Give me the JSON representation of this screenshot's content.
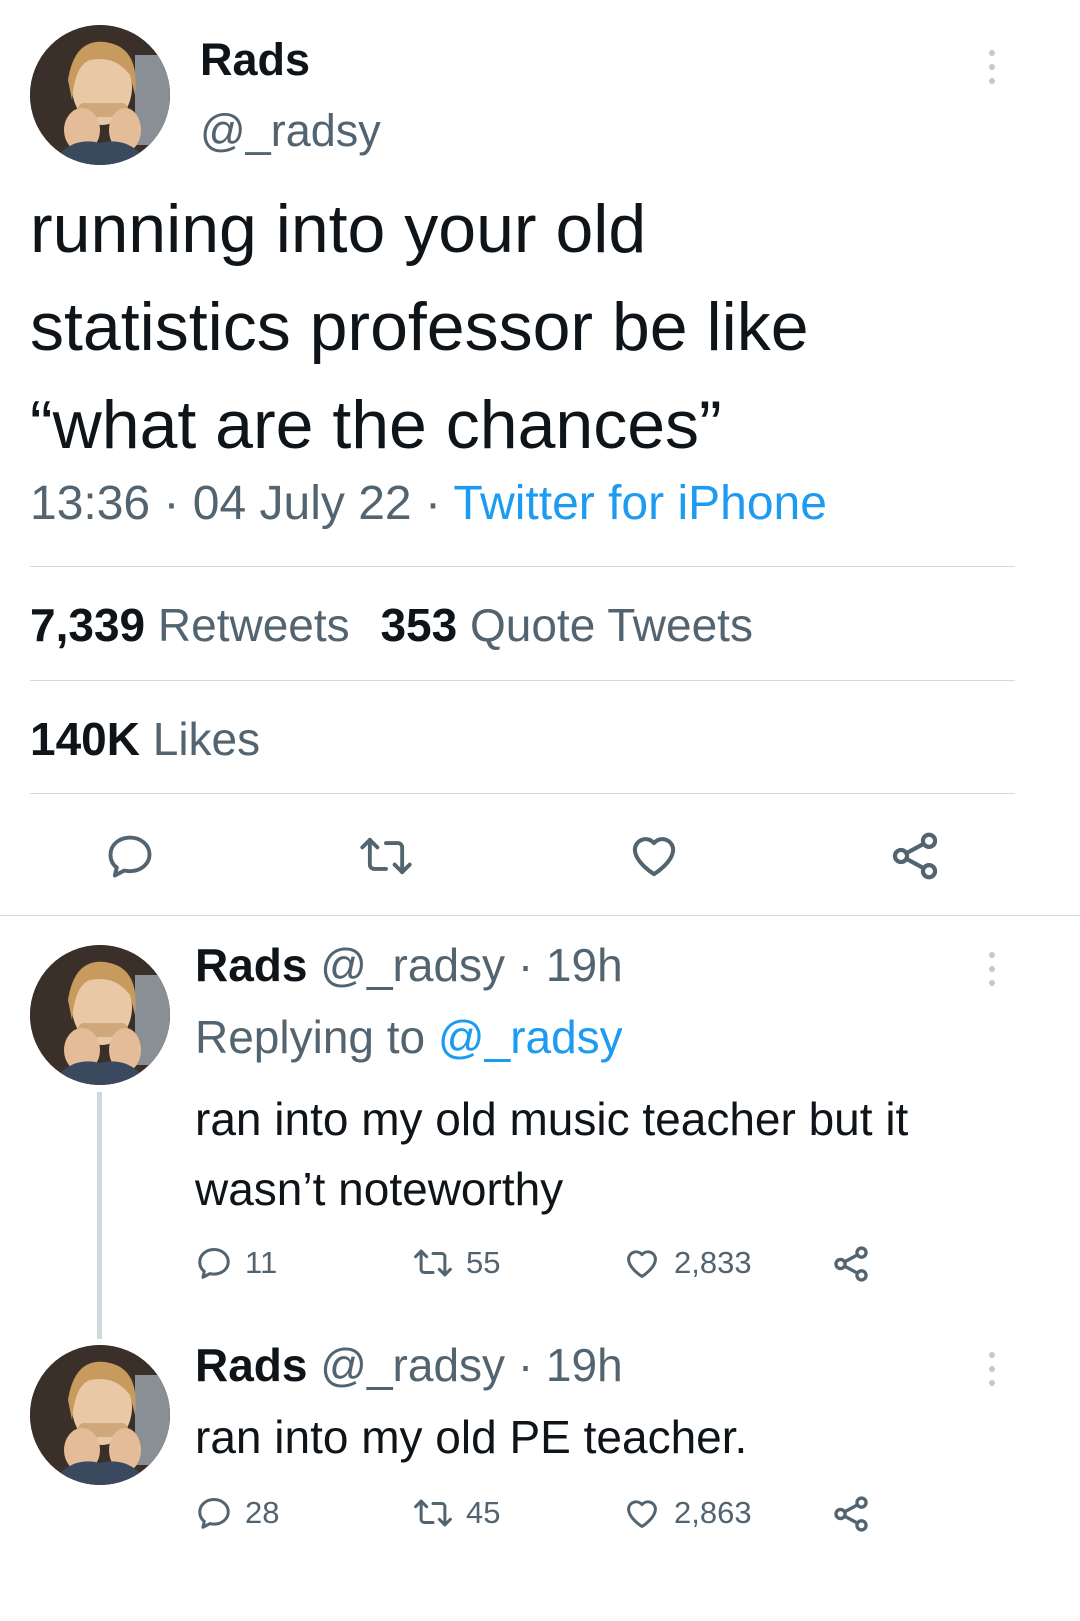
{
  "main_tweet": {
    "display_name": "Rads",
    "handle": "@_radsy",
    "text_lines": [
      "running into your old",
      "statistics professor be like",
      "“what are the chances”"
    ],
    "time": "13:36",
    "sep1": "·",
    "date": "04 July 22",
    "sep2": "·",
    "source": "Twitter for iPhone",
    "retweets_count": "7,339",
    "retweets_label": "Retweets",
    "quotes_count": "353",
    "quotes_label": "Quote Tweets",
    "likes_count": "140K",
    "likes_label": "Likes"
  },
  "replies": [
    {
      "display_name": "Rads",
      "handle": "@_radsy",
      "age": "· 19h",
      "replying_prefix": "Replying to",
      "replying_handle": "@_radsy",
      "text_lines": [
        "ran into my old music teacher but it",
        "wasn’t noteworthy"
      ],
      "reply_count": "11",
      "retweet_count": "55",
      "like_count": "2,833"
    },
    {
      "display_name": "Rads",
      "handle": "@_radsy",
      "age": "· 19h",
      "text_lines": [
        "ran into my old PE teacher."
      ],
      "reply_count": "28",
      "retweet_count": "45",
      "like_count": "2,863"
    }
  ],
  "icons": {
    "reply": "speech-bubble-icon",
    "retweet": "retweet-arrows-icon",
    "like": "heart-icon",
    "share": "share-nodes-icon",
    "more": "vertical-dots-icon"
  },
  "colors": {
    "text": "#0f1419",
    "muted": "#536471",
    "link": "#1d9bf0",
    "divider": "#d5d9dc"
  }
}
